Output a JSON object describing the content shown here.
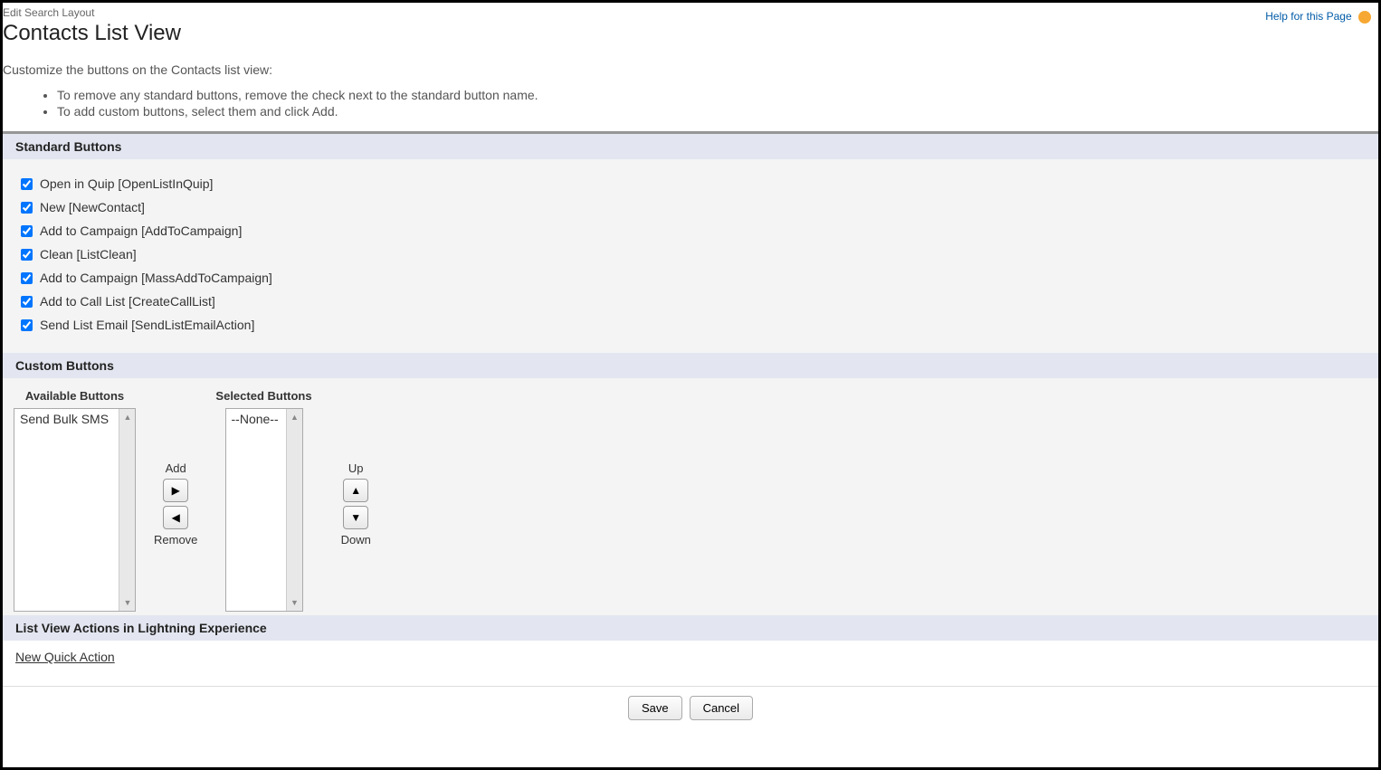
{
  "header": {
    "breadcrumb": "Edit Search Layout",
    "title": "Contacts List View",
    "help_link": "Help for this Page"
  },
  "intro": {
    "text": "Customize the buttons on the Contacts list view:",
    "bullets": [
      "To remove any standard buttons, remove the check next to the standard button name.",
      "To add custom buttons, select them and click Add."
    ]
  },
  "sections": {
    "standard": "Standard Buttons",
    "custom": "Custom Buttons",
    "lightning": "List View Actions in Lightning Experience"
  },
  "standard_buttons": [
    {
      "label": "Open in Quip [OpenListInQuip]",
      "checked": true
    },
    {
      "label": "New [NewContact]",
      "checked": true
    },
    {
      "label": "Add to Campaign [AddToCampaign]",
      "checked": true
    },
    {
      "label": "Clean [ListClean]",
      "checked": true
    },
    {
      "label": "Add to Campaign [MassAddToCampaign]",
      "checked": true
    },
    {
      "label": "Add to Call List [CreateCallList]",
      "checked": true
    },
    {
      "label": "Send List Email [SendListEmailAction]",
      "checked": true
    }
  ],
  "custom": {
    "available_label": "Available Buttons",
    "selected_label": "Selected Buttons",
    "available": [
      "Send Bulk SMS"
    ],
    "selected": [
      "--None--"
    ],
    "add": "Add",
    "remove": "Remove",
    "up": "Up",
    "down": "Down"
  },
  "lightning": {
    "new_action": "New Quick Action"
  },
  "footer": {
    "save": "Save",
    "cancel": "Cancel"
  }
}
